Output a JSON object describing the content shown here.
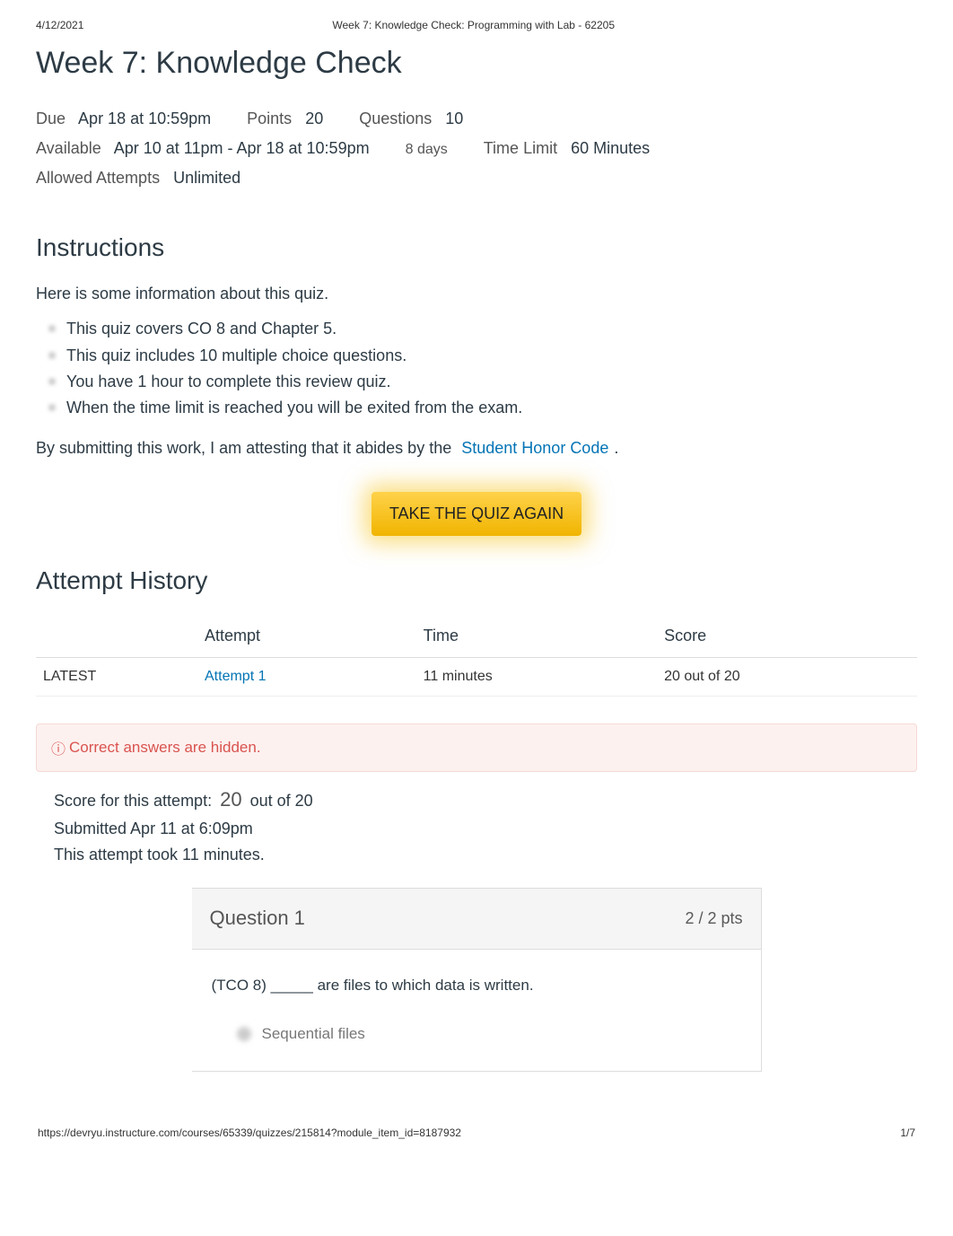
{
  "header": {
    "date": "4/12/2021",
    "title_line": "Week 7: Knowledge Check: Programming with Lab - 62205"
  },
  "page_title": "Week 7: Knowledge Check",
  "meta": {
    "due_label": "Due",
    "due_value": "Apr 18 at 10:59pm",
    "points_label": "Points",
    "points_value": "20",
    "questions_label": "Questions",
    "questions_value": "10",
    "available_label": "Available",
    "available_value": "Apr 10 at 11pm - Apr 18 at 10:59pm",
    "available_days": "8 days",
    "time_limit_label": "Time Limit",
    "time_limit_value": "60 Minutes",
    "attempts_label": "Allowed Attempts",
    "attempts_value": "Unlimited"
  },
  "instructions": {
    "heading": "Instructions",
    "intro": "Here is some information about this quiz.",
    "bullets": [
      "This quiz covers CO 8 and Chapter 5.",
      "This quiz includes 10 multiple choice questions.",
      "You have 1 hour to complete this review quiz.",
      "When the time limit is reached you will be exited from the exam."
    ],
    "attest_prefix": "By submitting this work, I am attesting that it abides by the",
    "honor_link": "Student Honor Code",
    "attest_suffix": "."
  },
  "take_quiz_button": "TAKE THE QUIZ AGAIN",
  "attempt_history": {
    "heading": "Attempt History",
    "columns": [
      "",
      "Attempt",
      "Time",
      "Score"
    ],
    "rows": [
      {
        "status": "LATEST",
        "attempt_link": "Attempt 1",
        "time": "11 minutes",
        "score": "20 out of 20"
      }
    ]
  },
  "hidden_banner": "Correct answers are hidden.",
  "score_block": {
    "prefix": "Score for this attempt:",
    "score_num": "20",
    "score_suffix": "out of 20",
    "submitted": "Submitted Apr 11 at 6:09pm",
    "duration": "This attempt took 11 minutes."
  },
  "question": {
    "title": "Question 1",
    "pts": "2 / 2 pts",
    "text": "(TCO 8) _____ are files to which data is written.",
    "answer_visible": "Sequential files"
  },
  "footer": {
    "url": "https://devryu.instructure.com/courses/65339/quizzes/215814?module_item_id=8187932",
    "page": "1/7"
  }
}
